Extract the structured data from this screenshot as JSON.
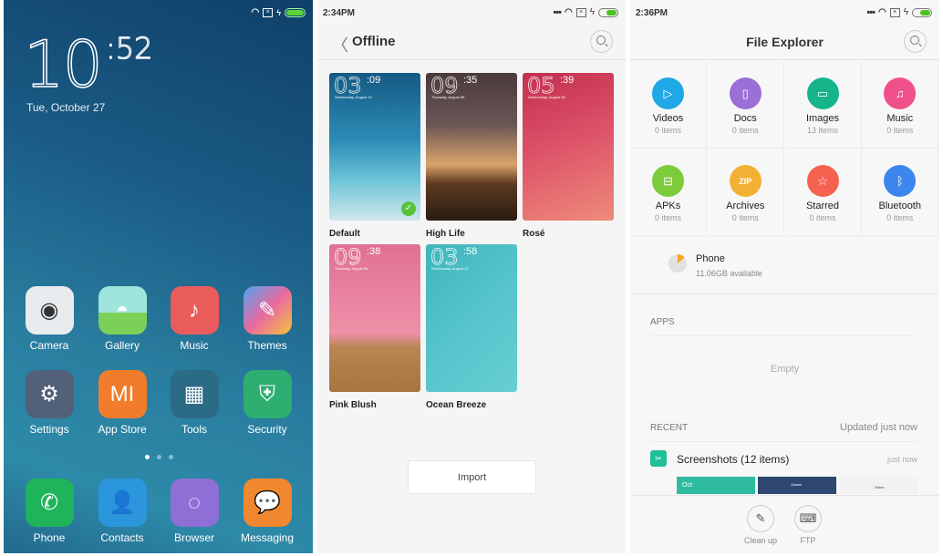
{
  "home": {
    "clock_hour": "10",
    "clock_minute": ":52",
    "date": "Tue, October 27",
    "apps": [
      {
        "label": "Camera",
        "icon": "camera-icon",
        "color": "#e9ecef"
      },
      {
        "label": "Gallery",
        "icon": "gallery-icon",
        "color": "#8fdbd0"
      },
      {
        "label": "Music",
        "icon": "music-note-icon",
        "color": "#ea5b5b"
      },
      {
        "label": "Themes",
        "icon": "paintbrush-icon",
        "color": "#e86aa0"
      },
      {
        "label": "Settings",
        "icon": "gear-icon",
        "color": "#52607a"
      },
      {
        "label": "App Store",
        "icon": "mi-shopping-bag-icon",
        "color": "#f07c2c"
      },
      {
        "label": "Tools",
        "icon": "folder-icon",
        "color": "#2c6b85"
      },
      {
        "label": "Security",
        "icon": "shield-plus-icon",
        "color": "#2fae72"
      }
    ],
    "dock": [
      {
        "label": "Phone",
        "icon": "phone-icon",
        "color": "#1fb45a"
      },
      {
        "label": "Contacts",
        "icon": "person-icon",
        "color": "#2b96dc"
      },
      {
        "label": "Browser",
        "icon": "browser-icon",
        "color": "#8f6fd6"
      },
      {
        "label": "Messaging",
        "icon": "chat-bubble-icon",
        "color": "#f1872e"
      }
    ],
    "page_count": 3,
    "current_page": 1
  },
  "themes_screen": {
    "status_time": "2:34PM",
    "title": "Offline",
    "themes": [
      {
        "name": "Default",
        "time_h": "03",
        "time_m": ":09",
        "date": "Wednesday, August 12",
        "selected": true
      },
      {
        "name": "High Life",
        "time_h": "09",
        "time_m": ":35",
        "date": "Thursday, August 06",
        "selected": false
      },
      {
        "name": "Rosé",
        "time_h": "05",
        "time_m": ":39",
        "date": "Wednesday, August 05",
        "selected": false
      },
      {
        "name": "Pink Blush",
        "time_h": "09",
        "time_m": ":38",
        "date": "Thursday, August 06",
        "selected": false
      },
      {
        "name": "Ocean Breeze",
        "time_h": "03",
        "time_m": ":58",
        "date": "Wednesday, August 12",
        "selected": false
      }
    ],
    "import_label": "Import"
  },
  "file_explorer": {
    "status_time": "2:36PM",
    "title": "File Explorer",
    "categories": [
      {
        "name": "Videos",
        "count": "0 items",
        "color": "#1fa8e6",
        "glyph": "▷"
      },
      {
        "name": "Docs",
        "count": "0 items",
        "color": "#9a6fd8",
        "glyph": "▯"
      },
      {
        "name": "Images",
        "count": "13 items",
        "color": "#15b48a",
        "glyph": "▭"
      },
      {
        "name": "Music",
        "count": "0 items",
        "color": "#f0508a",
        "glyph": "♫"
      },
      {
        "name": "APKs",
        "count": "0 items",
        "color": "#7ccb3a",
        "glyph": "⊟"
      },
      {
        "name": "Archives",
        "count": "0 items",
        "color": "#f2b134",
        "glyph": "ZIP"
      },
      {
        "name": "Starred",
        "count": "0 items",
        "color": "#f66250",
        "glyph": "☆"
      },
      {
        "name": "Bluetooth",
        "count": "0 items",
        "color": "#3d86ee",
        "glyph": "ᛒ"
      }
    ],
    "storage": {
      "name": "Phone",
      "available": "11.06GB available"
    },
    "apps_header": "APPS",
    "apps_empty": "Empty",
    "recent_header": "RECENT",
    "recent_updated": "Updated just now",
    "recent_item": {
      "name": "Screenshots (12 items)",
      "time": "just now"
    },
    "thumbnails": [
      "Oct",
      "Xiaomi",
      "Notes"
    ],
    "bottom": [
      {
        "label": "Clean up",
        "icon": "broom-icon",
        "glyph": "✎"
      },
      {
        "label": "FTP",
        "icon": "ftp-monitor-icon",
        "glyph": "⌨"
      }
    ]
  }
}
